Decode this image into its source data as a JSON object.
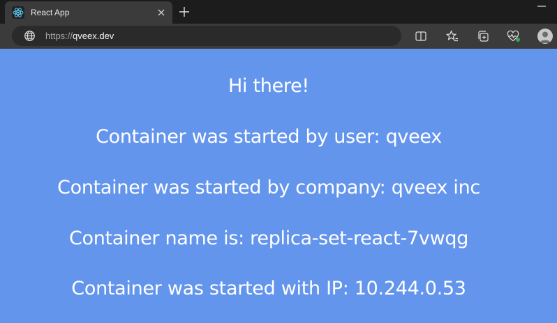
{
  "browser": {
    "tab_title": "React App",
    "url_scheme": "https://",
    "url_host": "qveex.dev"
  },
  "icons": {
    "favicon": "react-logo-icon",
    "close": "close-icon",
    "new_tab": "plus-icon",
    "minimize": "minimize-icon",
    "site_info": "globe-icon",
    "split_screen": "split-screen-icon",
    "favorites": "favorites-star-icon",
    "collections": "collections-icon",
    "browser_essentials": "heart-pulse-icon",
    "profile": "profile-avatar-icon"
  },
  "colors": {
    "page_background": "#6495ed",
    "text": "#ffffff",
    "tab_strip": "#1c1c1c",
    "toolbar": "#3b3b3b"
  },
  "page": {
    "greeting": "Hi there!",
    "user_line": "Container was started by user: qveex",
    "company_line": "Container was started by company: qveex inc",
    "name_line": "Container name is: replica-set-react-7vwqg",
    "ip_line": "Container was started with IP: 10.244.0.53"
  }
}
